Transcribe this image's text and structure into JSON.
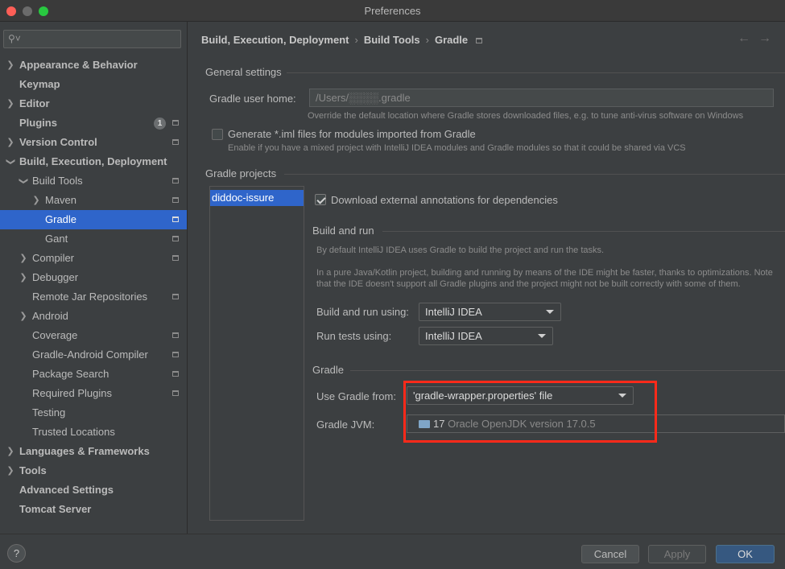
{
  "window": {
    "title": "Preferences"
  },
  "search": {
    "placeholder": ""
  },
  "sidebar": {
    "items": [
      {
        "label": "Appearance & Behavior"
      },
      {
        "label": "Keymap"
      },
      {
        "label": "Editor"
      },
      {
        "label": "Plugins",
        "badge": "1"
      },
      {
        "label": "Version Control"
      },
      {
        "label": "Build, Execution, Deployment"
      },
      {
        "label": "Build Tools"
      },
      {
        "label": "Maven"
      },
      {
        "label": "Gradle"
      },
      {
        "label": "Gant"
      },
      {
        "label": "Compiler"
      },
      {
        "label": "Debugger"
      },
      {
        "label": "Remote Jar Repositories"
      },
      {
        "label": "Android"
      },
      {
        "label": "Coverage"
      },
      {
        "label": "Gradle-Android Compiler"
      },
      {
        "label": "Package Search"
      },
      {
        "label": "Required Plugins"
      },
      {
        "label": "Testing"
      },
      {
        "label": "Trusted Locations"
      },
      {
        "label": "Languages & Frameworks"
      },
      {
        "label": "Tools"
      },
      {
        "label": "Advanced Settings"
      },
      {
        "label": "Tomcat Server"
      }
    ]
  },
  "breadcrumb": {
    "items": [
      "Build, Execution, Deployment",
      "Build Tools",
      "Gradle"
    ]
  },
  "general": {
    "title": "General settings",
    "user_home_label": "Gradle user home:",
    "user_home_value": "/Users/░░░░.gradle",
    "user_home_hint": "Override the default location where Gradle stores downloaded files, e.g. to tune anti-virus software on Windows",
    "iml_label": "Generate *.iml files for modules imported from Gradle",
    "iml_hint": "Enable if you have a mixed project with IntelliJ IDEA modules and Gradle modules so that it could be shared via VCS"
  },
  "projects": {
    "title": "Gradle projects",
    "items": [
      "diddoc-issure"
    ],
    "annotations_label": "Download external annotations for dependencies"
  },
  "build_run": {
    "title": "Build and run",
    "desc1": "By default IntelliJ IDEA uses Gradle to build the project and run the tasks.",
    "desc2": "In a pure Java/Kotlin project, building and running by means of the IDE might be faster, thanks to optimizations. Note",
    "desc3": "that the IDE doesn't support all Gradle plugins and the project might not be built correctly with some of them.",
    "build_label": "Build and run using:",
    "build_value": "IntelliJ IDEA",
    "tests_label": "Run tests using:",
    "tests_value": "IntelliJ IDEA"
  },
  "gradle": {
    "title": "Gradle",
    "use_from_label": "Use Gradle from:",
    "use_from_value": "'gradle-wrapper.properties' file",
    "jvm_label": "Gradle JVM:",
    "jvm_version": "17",
    "jvm_value": "Oracle OpenJDK version 17.0.5"
  },
  "footer": {
    "help": "?",
    "cancel": "Cancel",
    "apply": "Apply",
    "ok": "OK"
  },
  "colors": {
    "selection": "#2f65ca",
    "highlight": "#ff2a1a",
    "primary_button": "#365880"
  }
}
